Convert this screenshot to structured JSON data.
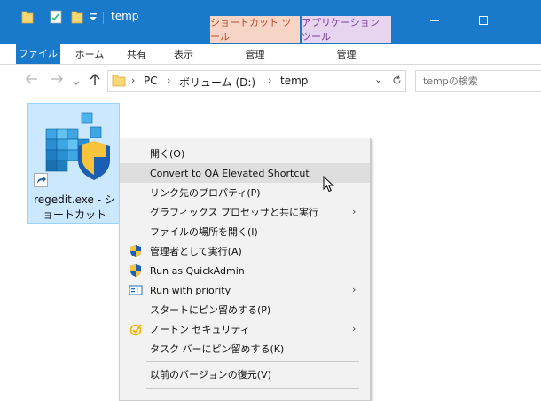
{
  "titlebar": {
    "title": "temp",
    "contextual_tabs": [
      {
        "label": "ショートカット ツール"
      },
      {
        "label": "アプリケーション ツール"
      }
    ]
  },
  "ribbon": {
    "tabs": [
      {
        "label": "ファイル"
      },
      {
        "label": "ホーム"
      },
      {
        "label": "共有"
      },
      {
        "label": "表示"
      },
      {
        "label": "管理"
      },
      {
        "label": "管理"
      }
    ]
  },
  "address": {
    "crumbs": [
      "PC",
      "ボリューム (D:)",
      "temp"
    ],
    "search_placeholder": "tempの検索"
  },
  "file": {
    "name_line1": "regedit.exe - シ",
    "name_line2": "ョートカット"
  },
  "context_menu": {
    "items": [
      {
        "label": "開く(O)",
        "icon": "none",
        "submenu": false
      },
      {
        "label": "Convert to QA Elevated Shortcut",
        "icon": "none",
        "submenu": false,
        "highlighted": true
      },
      {
        "label": "リンク先のプロパティ(P)",
        "icon": "none",
        "submenu": false
      },
      {
        "label": "グラフィックス プロセッサと共に実行",
        "icon": "none",
        "submenu": true
      },
      {
        "label": "ファイルの場所を開く(I)",
        "icon": "none",
        "submenu": false
      },
      {
        "label": "管理者として実行(A)",
        "icon": "uac-shield-icon",
        "submenu": false
      },
      {
        "label": "Run as QuickAdmin",
        "icon": "uac-shield-icon",
        "submenu": false
      },
      {
        "label": "Run with priority",
        "icon": "priority-icon",
        "submenu": true
      },
      {
        "label": "スタートにピン留めする(P)",
        "icon": "none",
        "submenu": false
      },
      {
        "label": "ノートン セキュリティ",
        "icon": "norton-check-icon",
        "submenu": true
      },
      {
        "label": "タスク バーにピン留めする(K)",
        "icon": "none",
        "submenu": false
      },
      {
        "label": "以前のバージョンの復元(V)",
        "icon": "none",
        "submenu": false
      }
    ],
    "submenu_glyph": "›"
  },
  "colors": {
    "titlebar": "#1979ca",
    "shortcut_tools_tab": "#f6d5c6",
    "app_tools_tab": "#e7d5ef",
    "selection": "#cce8ff",
    "menu_bg": "#f2f2f2",
    "menu_highlight": "#dedede"
  }
}
